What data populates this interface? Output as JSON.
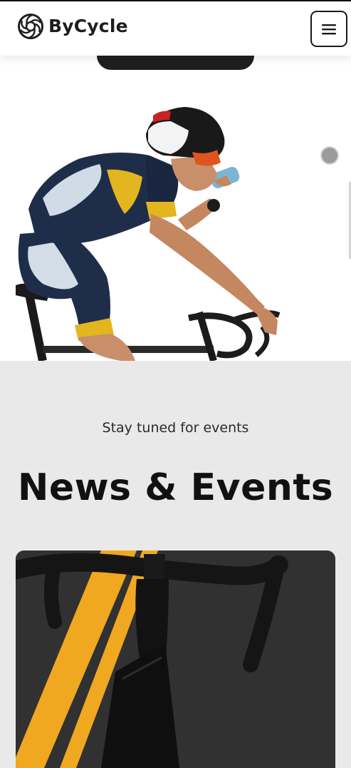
{
  "header": {
    "brand_name": "ByCycle",
    "logo_icon": "cycle-wheel-logo-icon",
    "menu_icon": "hamburger-menu-icon"
  },
  "hero": {
    "image": "cyclist-drinking-from-bottle-photo"
  },
  "events_section": {
    "subtitle": "Stay tuned for events",
    "title": "News & Events",
    "card_image": "bicycle-handlebar-on-road-photo"
  },
  "colors": {
    "header_bg": "#ffffff",
    "section_bg": "#e9e9e9",
    "text_dark": "#111111",
    "road_yellow": "#f0a821"
  }
}
